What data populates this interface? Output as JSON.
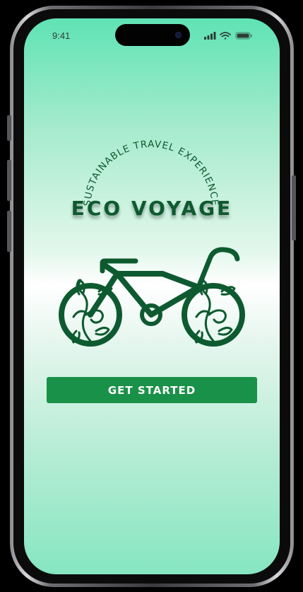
{
  "status_bar": {
    "time": "9:41"
  },
  "brand": {
    "tagline": "SUSTAINABLE TRAVEL EXPERIENCE",
    "title": "ECO VOYAGE",
    "logo_icon": "bicycle-leaf-icon"
  },
  "cta": {
    "label": "GET STARTED"
  },
  "colors": {
    "brand_green": "#0e5a30",
    "button_green": "#1a9148",
    "gradient_top": "#5fe3b5",
    "gradient_bottom": "#86e6c1"
  }
}
